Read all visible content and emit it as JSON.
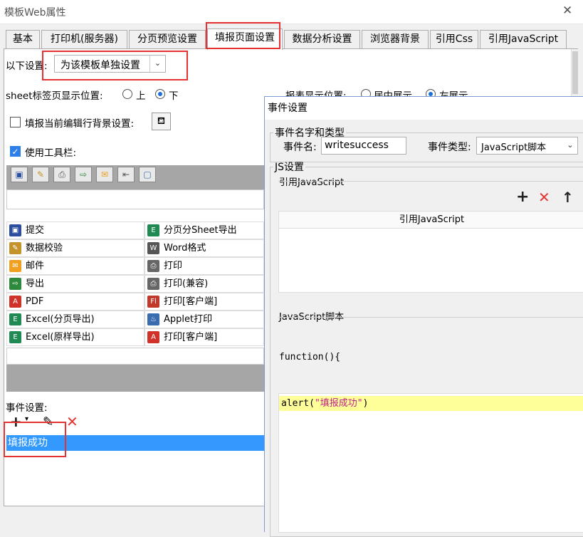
{
  "window": {
    "title": "模板Web属性",
    "close": "✕"
  },
  "tabs": [
    "基本",
    "打印机(服务器)",
    "分页预览设置",
    "填报页面设置",
    "数据分析设置",
    "浏览器背景",
    "引用Css",
    "引用JavaScript"
  ],
  "settings": {
    "scope_label": "以下设置:",
    "scope_value": "为该模板单独设置",
    "sheet_pos_label": "sheet标签页显示位置:",
    "sheet_pos_options": [
      "上",
      "下"
    ],
    "sheet_pos_selected": "下",
    "report_pos_label": "报表显示位置:",
    "report_pos_options": [
      "居中展示",
      "左展示"
    ],
    "report_pos_selected": "左展示",
    "edit_row_bg_label": "填报当前编辑行背景设置:",
    "use_toolbar_label": "使用工具栏:"
  },
  "toolbar_buttons": [
    {
      "left": [
        {
          "icon": "save-icon",
          "label": "提交",
          "color": "#2b4f9e",
          "glyph": "▣"
        },
        {
          "icon": "check-icon",
          "label": "数据校验",
          "color": "#c4932b",
          "glyph": "✎"
        },
        {
          "icon": "mail-icon",
          "label": "邮件",
          "color": "#f0a020",
          "glyph": "✉"
        },
        {
          "icon": "export-icon",
          "label": "导出",
          "color": "#2d8a3d",
          "glyph": "⇨"
        },
        {
          "icon": "pdf-icon",
          "label": "PDF",
          "color": "#d0322a",
          "glyph": "A"
        },
        {
          "icon": "excel-icon",
          "label": "Excel(分页导出)",
          "color": "#1f8a52",
          "glyph": "E"
        },
        {
          "icon": "excel-icon",
          "label": "Excel(原样导出)",
          "color": "#1f8a52",
          "glyph": "E"
        }
      ]
    },
    {
      "right": [
        {
          "icon": "excel-icon",
          "label": "分页分Sheet导出",
          "color": "#1f8a52",
          "glyph": "E"
        },
        {
          "icon": "word-icon",
          "label": "Word格式",
          "color": "#555555",
          "glyph": "W"
        },
        {
          "icon": "print-icon",
          "label": "打印",
          "color": "#666666",
          "glyph": "⎙"
        },
        {
          "icon": "print-icon",
          "label": "打印(兼容)",
          "color": "#666666",
          "glyph": "⎙"
        },
        {
          "icon": "flash-icon",
          "label": "打印[客户端]",
          "color": "#c0392b",
          "glyph": "Fl"
        },
        {
          "icon": "applet-icon",
          "label": "Applet打印",
          "color": "#3a6cb0",
          "glyph": "♨"
        },
        {
          "icon": "pdf-icon",
          "label": "打印[客户端]",
          "color": "#d0322a",
          "glyph": "A"
        }
      ]
    }
  ],
  "events": {
    "label": "事件设置:",
    "items": [
      "填报成功"
    ]
  },
  "dialog": {
    "title": "事件设置",
    "group_name": "事件名字和类型",
    "event_name_label": "事件名:",
    "event_name_value": "writesuccess",
    "event_type_label": "事件类型:",
    "event_type_value": "JavaScript脚本",
    "js_group": "JS设置",
    "ref_js_label": "引用JavaScript",
    "ref_js_header": "引用JavaScript",
    "script_label": "JavaScript脚本",
    "function_sig": "function(){",
    "code_fn": "alert(",
    "code_str": "\"填报成功\"",
    "code_end": ")"
  },
  "colors": {
    "accent": "#3399ff",
    "red": "#e53333",
    "highlight": "#ffff99"
  }
}
